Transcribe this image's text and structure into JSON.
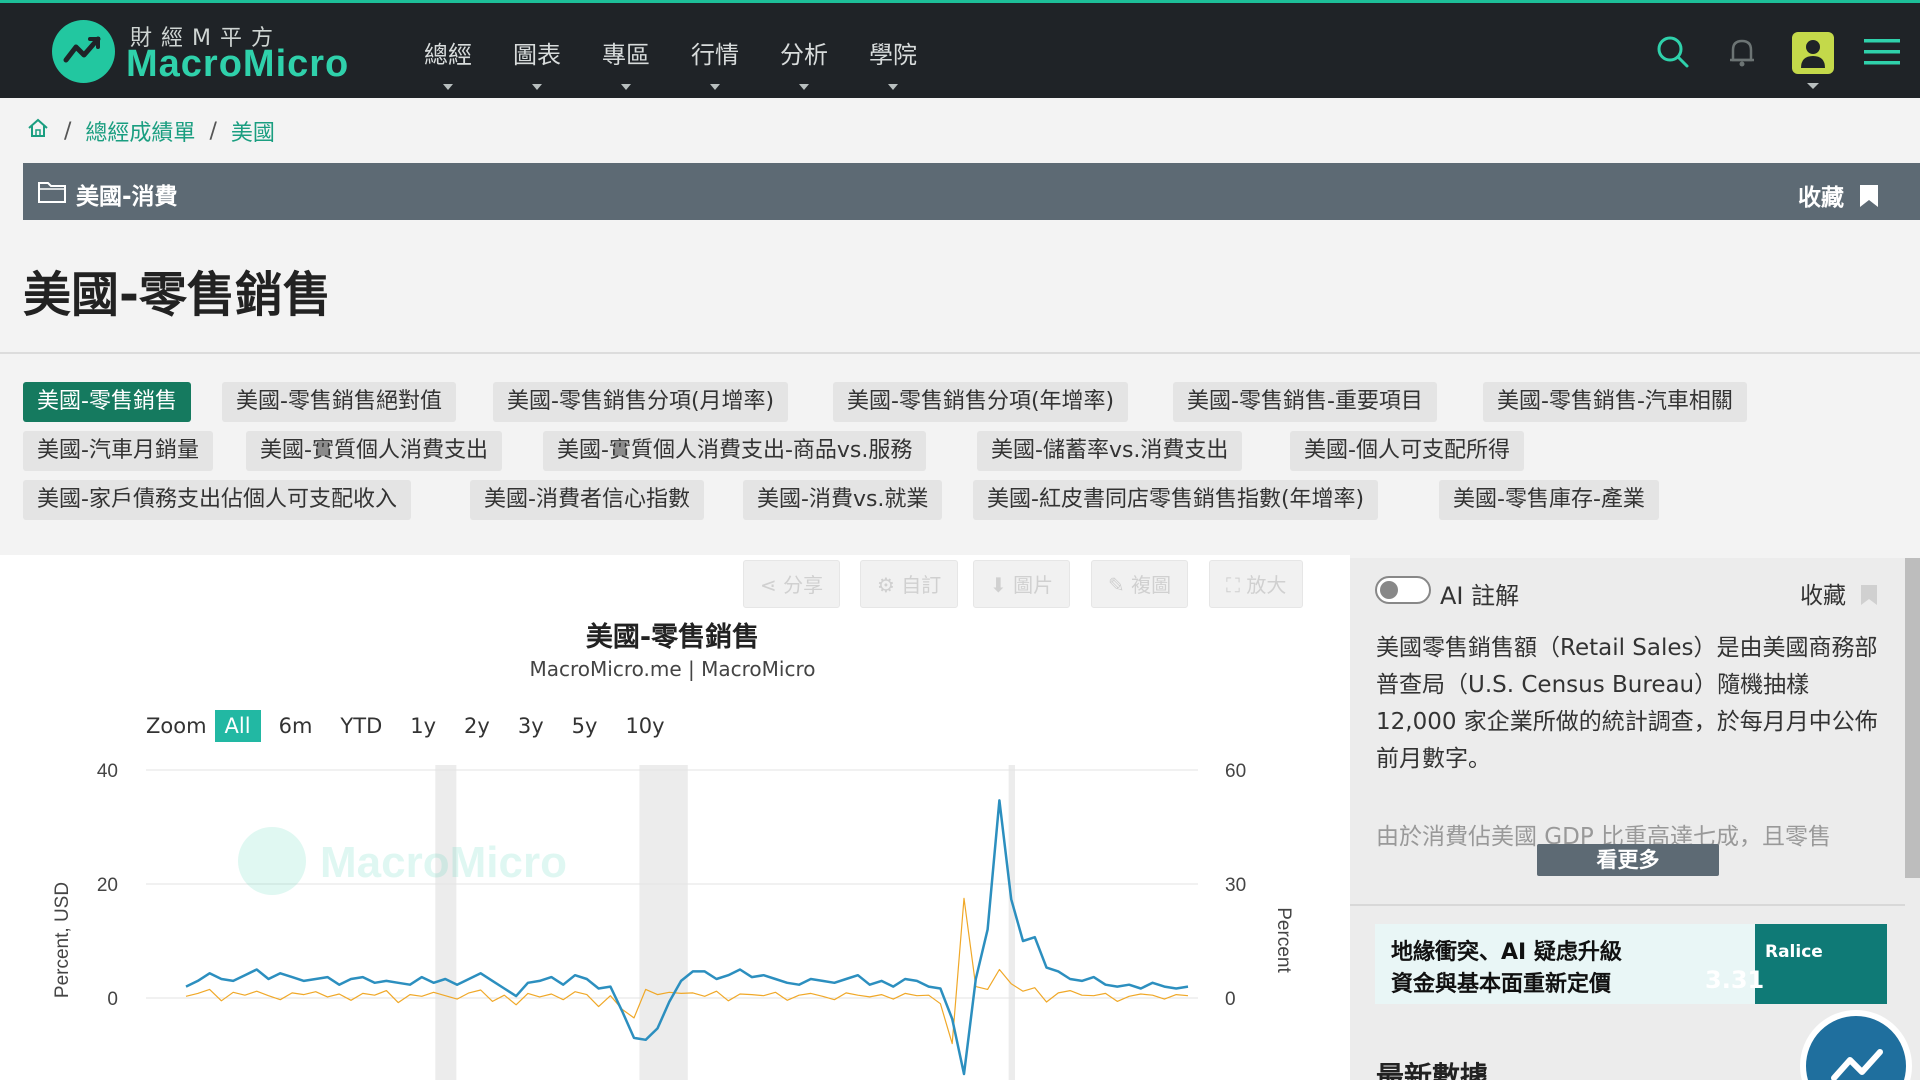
{
  "brand": {
    "cn": "財經M平方",
    "en": "MacroMicro"
  },
  "nav": {
    "items": [
      "總經",
      "圖表",
      "專區",
      "行情",
      "分析",
      "學院"
    ]
  },
  "breadcrumb": {
    "items": [
      "總經成績單",
      "美國"
    ]
  },
  "category_bar": {
    "title": "美國-消費",
    "favorite": "收藏"
  },
  "page_title": "美國-零售銷售",
  "tags": [
    "美國-零售銷售",
    "美國-零售銷售絕對值",
    "美國-零售銷售分項(月增率)",
    "美國-零售銷售分項(年增率)",
    "美國-零售銷售-重要項目",
    "美國-零售銷售-汽車相關",
    "美國-汽車月銷量",
    "美國-實質個人消費支出",
    "美國-實質個人消費支出-商品vs.服務",
    "美國-儲蓄率vs.消費支出",
    "美國-個人可支配所得",
    "美國-家戶債務支出佔個人可支配收入",
    "美國-消費者信心指數",
    "美國-消費vs.就業",
    "美國-紅皮書同店零售銷售指數(年增率)",
    "美國-零售庫存-產業"
  ],
  "toolbar": {
    "share": "分享",
    "custom": "自訂",
    "image": "圖片",
    "copy": "複圖",
    "expand": "放大"
  },
  "chart": {
    "title": "美國-零售銷售",
    "subtitle": "MacroMicro.me | MacroMicro",
    "watermark": "MacroMicro",
    "zoom_label": "Zoom",
    "zoom_options": [
      "All",
      "6m",
      "YTD",
      "1y",
      "2y",
      "3y",
      "5y",
      "10y"
    ],
    "zoom_selected": "All"
  },
  "chart_data": {
    "type": "line",
    "ylabel_left": "Percent, USD",
    "ylabel_right": "Percent",
    "left_ticks": [
      0,
      20,
      40
    ],
    "right_ticks": [
      0,
      30,
      60
    ],
    "ylim_left": [
      0,
      40
    ],
    "ylim_right": [
      0,
      60
    ],
    "series": [
      {
        "axis": "right",
        "color": "#2c8fbf",
        "values": [
          3,
          4.5,
          6.5,
          5,
          4.5,
          6,
          7.5,
          5,
          6.5,
          5.5,
          4.5,
          5,
          5.5,
          3.5,
          5,
          5.5,
          4,
          4.5,
          4,
          3.5,
          5.5,
          4,
          5,
          3.5,
          5,
          6.5,
          4.5,
          2.5,
          0.5,
          4,
          4.5,
          5.5,
          3.5,
          6,
          5,
          2.5,
          3,
          -3.5,
          -10.5,
          -11,
          -8,
          -1,
          4.5,
          7,
          7,
          5,
          6,
          7.5,
          5.5,
          6,
          5,
          4,
          3.5,
          5,
          4.5,
          4,
          5,
          6,
          3.5,
          4.5,
          3,
          5,
          4.5,
          3,
          2.5,
          -5.5,
          -20,
          5,
          18,
          52,
          26,
          15,
          16,
          8,
          7,
          5,
          4.5,
          5.5,
          3.5,
          3,
          3.5,
          2.5,
          4,
          3,
          2.5,
          3
        ],
        "note": "solid line (right axis, 0–60 scale)"
      },
      {
        "axis": "left",
        "color": "#f0a828",
        "values": [
          0.3,
          0.8,
          1.5,
          -0.5,
          1,
          0.5,
          1.2,
          0.4,
          -0.3,
          0.9,
          0.6,
          1.1,
          0.2,
          0.7,
          -0.4,
          0.8,
          0.5,
          1.3,
          -0.8,
          0.6,
          0.3,
          1,
          0.4,
          -0.2,
          0.9,
          1.4,
          -0.6,
          0.5,
          -1.2,
          0.8,
          0.2,
          0.7,
          -0.3,
          1.1,
          0.6,
          -1.5,
          0.4,
          -2,
          -3.5,
          1.5,
          0.6,
          1,
          0.8,
          0.9,
          0.3,
          1.2,
          -0.5,
          0.7,
          0.6,
          0.4,
          1,
          -0.4,
          0.5,
          0.8,
          0.3,
          -0.3,
          0.9,
          0.5,
          0.2,
          0.6,
          -0.2,
          0.8,
          0.4,
          0.5,
          -1,
          -8,
          17.5,
          2,
          1.5,
          5,
          2.5,
          1.2,
          1.8,
          -0.7,
          0.9,
          1.3,
          0.5,
          0.4,
          0.8,
          -0.6,
          0.3,
          0.7,
          0.5,
          -0.2,
          0.6,
          0.4
        ]
      }
    ],
    "recession_bands": [
      [
        0.275,
        0.295
      ],
      [
        0.469,
        0.515
      ],
      [
        0.82,
        0.826
      ]
    ]
  },
  "side": {
    "ai_label": "AI 註解",
    "favorite": "收藏",
    "description": "美國零售銷售額（Retail Sales）是由美國商務部普查局（U.S. Census Bureau）隨機抽樣12,000 家企業所做的統計調查，於每月月中公佈前月數字。",
    "description_cont": "由於消費佔美國 GDP 比重高達七成，且零售",
    "more_button": "看更多",
    "banner": {
      "line1": "地緣衝突、AI 疑虑升級",
      "line2": "資金與基本面重新定價",
      "brand": "Ralice",
      "date": "3.31"
    },
    "latest_data": "最新數據"
  }
}
